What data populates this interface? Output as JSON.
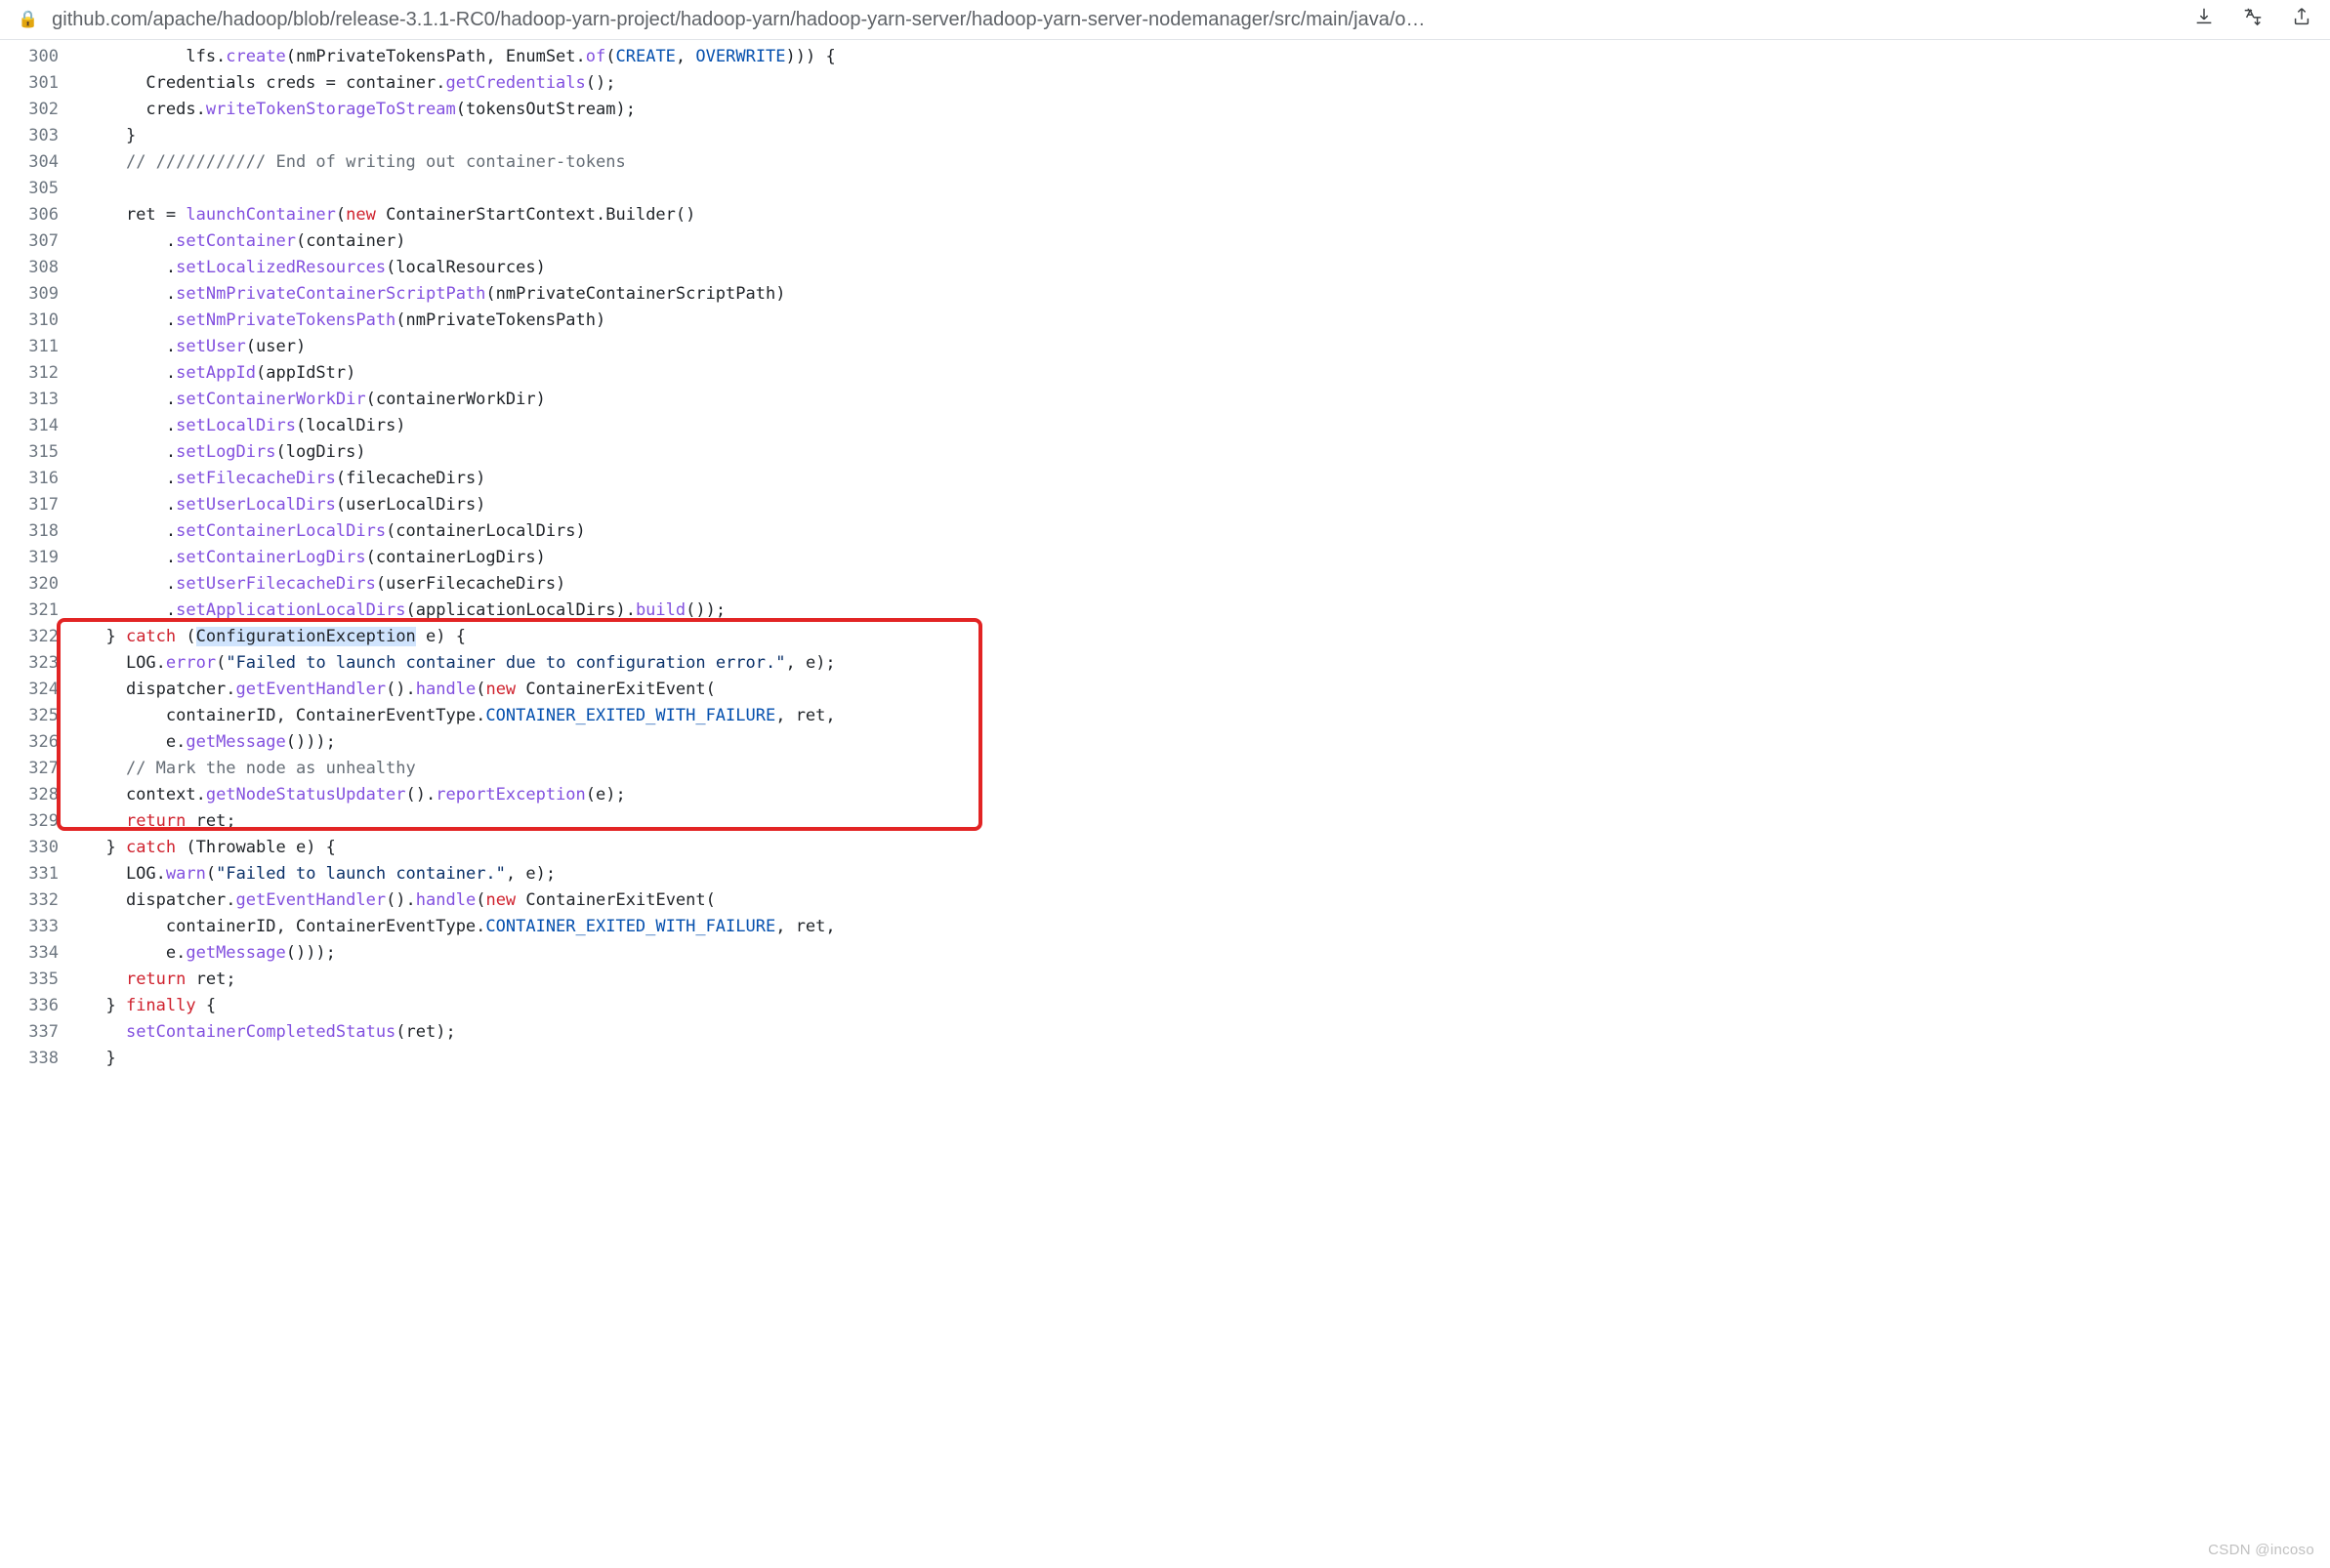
{
  "url": "github.com/apache/hadoop/blob/release-3.1.1-RC0/hadoop-yarn-project/hadoop-yarn/hadoop-yarn-server/hadoop-yarn-server-nodemanager/src/main/java/o…",
  "watermark": "CSDN @incoso",
  "lines": [
    {
      "n": 300,
      "seg": [
        [
          "p",
          "          lfs."
        ],
        [
          "f",
          "create"
        ],
        [
          "p",
          "(nmPrivateTokensPath, EnumSet."
        ],
        [
          "f",
          "of"
        ],
        [
          "p",
          "("
        ],
        [
          "b",
          "CREATE"
        ],
        [
          "p",
          ", "
        ],
        [
          "b",
          "OVERWRITE"
        ],
        [
          "p",
          "))) {"
        ]
      ]
    },
    {
      "n": 301,
      "seg": [
        [
          "p",
          "      Credentials creds = container."
        ],
        [
          "f",
          "getCredentials"
        ],
        [
          "p",
          "();"
        ]
      ]
    },
    {
      "n": 302,
      "seg": [
        [
          "p",
          "      creds."
        ],
        [
          "f",
          "writeTokenStorageToStream"
        ],
        [
          "p",
          "(tokensOutStream);"
        ]
      ]
    },
    {
      "n": 303,
      "seg": [
        [
          "p",
          "    }"
        ]
      ]
    },
    {
      "n": 304,
      "seg": [
        [
          "p",
          "    "
        ],
        [
          "c",
          "// /////////// End of writing out container-tokens"
        ]
      ]
    },
    {
      "n": 305,
      "seg": [
        [
          "p",
          ""
        ]
      ]
    },
    {
      "n": 306,
      "seg": [
        [
          "p",
          "    ret = "
        ],
        [
          "f",
          "launchContainer"
        ],
        [
          "p",
          "("
        ],
        [
          "k",
          "new"
        ],
        [
          "p",
          " ContainerStartContext.Builder()"
        ]
      ]
    },
    {
      "n": 307,
      "seg": [
        [
          "p",
          "        ."
        ],
        [
          "f",
          "setContainer"
        ],
        [
          "p",
          "(container)"
        ]
      ]
    },
    {
      "n": 308,
      "seg": [
        [
          "p",
          "        ."
        ],
        [
          "f",
          "setLocalizedResources"
        ],
        [
          "p",
          "(localResources)"
        ]
      ]
    },
    {
      "n": 309,
      "seg": [
        [
          "p",
          "        ."
        ],
        [
          "f",
          "setNmPrivateContainerScriptPath"
        ],
        [
          "p",
          "(nmPrivateContainerScriptPath)"
        ]
      ]
    },
    {
      "n": 310,
      "seg": [
        [
          "p",
          "        ."
        ],
        [
          "f",
          "setNmPrivateTokensPath"
        ],
        [
          "p",
          "(nmPrivateTokensPath)"
        ]
      ]
    },
    {
      "n": 311,
      "seg": [
        [
          "p",
          "        ."
        ],
        [
          "f",
          "setUser"
        ],
        [
          "p",
          "(user)"
        ]
      ]
    },
    {
      "n": 312,
      "seg": [
        [
          "p",
          "        ."
        ],
        [
          "f",
          "setAppId"
        ],
        [
          "p",
          "(appIdStr)"
        ]
      ]
    },
    {
      "n": 313,
      "seg": [
        [
          "p",
          "        ."
        ],
        [
          "f",
          "setContainerWorkDir"
        ],
        [
          "p",
          "(containerWorkDir)"
        ]
      ]
    },
    {
      "n": 314,
      "seg": [
        [
          "p",
          "        ."
        ],
        [
          "f",
          "setLocalDirs"
        ],
        [
          "p",
          "(localDirs)"
        ]
      ]
    },
    {
      "n": 315,
      "seg": [
        [
          "p",
          "        ."
        ],
        [
          "f",
          "setLogDirs"
        ],
        [
          "p",
          "(logDirs)"
        ]
      ]
    },
    {
      "n": 316,
      "seg": [
        [
          "p",
          "        ."
        ],
        [
          "f",
          "setFilecacheDirs"
        ],
        [
          "p",
          "(filecacheDirs)"
        ]
      ]
    },
    {
      "n": 317,
      "seg": [
        [
          "p",
          "        ."
        ],
        [
          "f",
          "setUserLocalDirs"
        ],
        [
          "p",
          "(userLocalDirs)"
        ]
      ]
    },
    {
      "n": 318,
      "seg": [
        [
          "p",
          "        ."
        ],
        [
          "f",
          "setContainerLocalDirs"
        ],
        [
          "p",
          "(containerLocalDirs)"
        ]
      ]
    },
    {
      "n": 319,
      "seg": [
        [
          "p",
          "        ."
        ],
        [
          "f",
          "setContainerLogDirs"
        ],
        [
          "p",
          "(containerLogDirs)"
        ]
      ]
    },
    {
      "n": 320,
      "seg": [
        [
          "p",
          "        ."
        ],
        [
          "f",
          "setUserFilecacheDirs"
        ],
        [
          "p",
          "(userFilecacheDirs)"
        ]
      ]
    },
    {
      "n": 321,
      "seg": [
        [
          "p",
          "        ."
        ],
        [
          "f",
          "setApplicationLocalDirs"
        ],
        [
          "p",
          "(applicationLocalDirs)."
        ],
        [
          "f",
          "build"
        ],
        [
          "p",
          "());"
        ]
      ]
    },
    {
      "n": 322,
      "seg": [
        [
          "p",
          "  } "
        ],
        [
          "k",
          "catch"
        ],
        [
          "p",
          " ("
        ],
        [
          "sel",
          "ConfigurationException"
        ],
        [
          "p",
          " e) {"
        ]
      ]
    },
    {
      "n": 323,
      "seg": [
        [
          "p",
          "    LOG."
        ],
        [
          "f",
          "error"
        ],
        [
          "p",
          "("
        ],
        [
          "s",
          "\"Failed to launch container due to configuration error.\""
        ],
        [
          "p",
          ", e);"
        ]
      ]
    },
    {
      "n": 324,
      "seg": [
        [
          "p",
          "    dispatcher."
        ],
        [
          "f",
          "getEventHandler"
        ],
        [
          "p",
          "()."
        ],
        [
          "f",
          "handle"
        ],
        [
          "p",
          "("
        ],
        [
          "k",
          "new"
        ],
        [
          "p",
          " ContainerExitEvent("
        ]
      ]
    },
    {
      "n": 325,
      "seg": [
        [
          "p",
          "        containerID, ContainerEventType."
        ],
        [
          "b",
          "CONTAINER_EXITED_WITH_FAILURE"
        ],
        [
          "p",
          ", ret,"
        ]
      ]
    },
    {
      "n": 326,
      "seg": [
        [
          "p",
          "        e."
        ],
        [
          "f",
          "getMessage"
        ],
        [
          "p",
          "()));"
        ]
      ]
    },
    {
      "n": 327,
      "seg": [
        [
          "p",
          "    "
        ],
        [
          "c",
          "// Mark the node as unhealthy"
        ]
      ]
    },
    {
      "n": 328,
      "seg": [
        [
          "p",
          "    context."
        ],
        [
          "f",
          "getNodeStatusUpdater"
        ],
        [
          "p",
          "()."
        ],
        [
          "f",
          "reportException"
        ],
        [
          "p",
          "(e);"
        ]
      ]
    },
    {
      "n": 329,
      "seg": [
        [
          "p",
          "    "
        ],
        [
          "k",
          "return"
        ],
        [
          "p",
          " ret;"
        ]
      ]
    },
    {
      "n": 330,
      "seg": [
        [
          "p",
          "  } "
        ],
        [
          "k",
          "catch"
        ],
        [
          "p",
          " (Throwable e) {"
        ]
      ]
    },
    {
      "n": 331,
      "seg": [
        [
          "p",
          "    LOG."
        ],
        [
          "f",
          "warn"
        ],
        [
          "p",
          "("
        ],
        [
          "s",
          "\"Failed to launch container.\""
        ],
        [
          "p",
          ", e);"
        ]
      ]
    },
    {
      "n": 332,
      "seg": [
        [
          "p",
          "    dispatcher."
        ],
        [
          "f",
          "getEventHandler"
        ],
        [
          "p",
          "()."
        ],
        [
          "f",
          "handle"
        ],
        [
          "p",
          "("
        ],
        [
          "k",
          "new"
        ],
        [
          "p",
          " ContainerExitEvent("
        ]
      ]
    },
    {
      "n": 333,
      "seg": [
        [
          "p",
          "        containerID, ContainerEventType."
        ],
        [
          "b",
          "CONTAINER_EXITED_WITH_FAILURE"
        ],
        [
          "p",
          ", ret,"
        ]
      ]
    },
    {
      "n": 334,
      "seg": [
        [
          "p",
          "        e."
        ],
        [
          "f",
          "getMessage"
        ],
        [
          "p",
          "()));"
        ]
      ]
    },
    {
      "n": 335,
      "seg": [
        [
          "p",
          "    "
        ],
        [
          "k",
          "return"
        ],
        [
          "p",
          " ret;"
        ]
      ]
    },
    {
      "n": 336,
      "seg": [
        [
          "p",
          "  } "
        ],
        [
          "k",
          "finally"
        ],
        [
          "p",
          " {"
        ]
      ]
    },
    {
      "n": 337,
      "seg": [
        [
          "p",
          "    "
        ],
        [
          "f",
          "setContainerCompletedStatus"
        ],
        [
          "p",
          "(ret);"
        ]
      ]
    },
    {
      "n": 338,
      "seg": [
        [
          "p",
          "  }"
        ]
      ]
    }
  ],
  "highlight": {
    "start": 322,
    "end": 329
  }
}
